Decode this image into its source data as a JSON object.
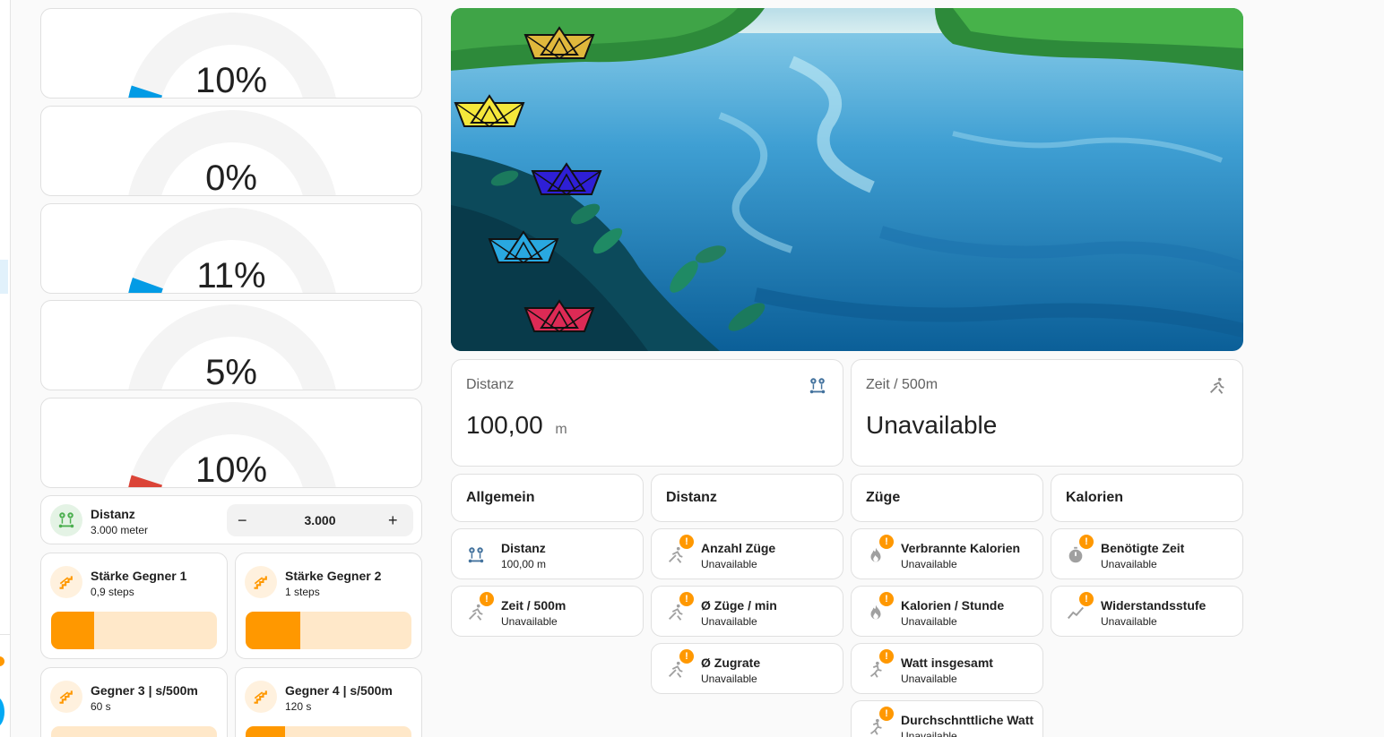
{
  "gauges": [
    {
      "label": "10%",
      "value": 10,
      "color": "#039be5"
    },
    {
      "label": "0%",
      "value": 0,
      "color": "#039be5"
    },
    {
      "label": "11%",
      "value": 11,
      "color": "#039be5"
    },
    {
      "label": "5%",
      "value": 5,
      "color": "#039be5"
    },
    {
      "label": "10%",
      "value": 10,
      "color": "#db4437"
    }
  ],
  "distance_input": {
    "name": "Distanz",
    "sub": "3.000 meter",
    "value": "3.000",
    "minus": "−",
    "plus": "+"
  },
  "opponents": [
    {
      "name": "Stärke Gegner 1",
      "sub": "0,9 steps",
      "fill": 0.26
    },
    {
      "name": "Stärke Gegner 2",
      "sub": "1 steps",
      "fill": 0.33
    },
    {
      "name": "Gegner 3 | s/500m",
      "sub": "60 s",
      "fill": 0.0
    },
    {
      "name": "Gegner 4 | s/500m",
      "sub": "120 s",
      "fill": 0.24
    }
  ],
  "boats": [
    {
      "color": "#e0b83c"
    },
    {
      "color": "#f5e83b"
    },
    {
      "color": "#2e1fd6"
    },
    {
      "color": "#29a8e0"
    },
    {
      "color": "#dd2a55"
    }
  ],
  "stat_distance": {
    "title": "Distanz",
    "value": "100,00",
    "unit": "m"
  },
  "stat_time": {
    "title": "Zeit / 500m",
    "value": "Unavailable"
  },
  "columns": [
    {
      "header": "Allgemein",
      "tiles": [
        {
          "name": "Distanz",
          "state": "100,00 m",
          "icon": "map-marker-distance-icon",
          "warn": false
        },
        {
          "name": "Zeit / 500m",
          "state": "Unavailable",
          "icon": "rowing-icon",
          "warn": true
        }
      ]
    },
    {
      "header": "Distanz",
      "tiles": [
        {
          "name": "Anzahl Züge",
          "state": "Unavailable",
          "icon": "rowing-icon",
          "warn": true
        },
        {
          "name": "Ø Züge / min",
          "state": "Unavailable",
          "icon": "rowing-icon",
          "warn": true
        },
        {
          "name": "Ø Zugrate",
          "state": "Unavailable",
          "icon": "rowing-icon",
          "warn": true
        }
      ]
    },
    {
      "header": "Züge",
      "tiles": [
        {
          "name": "Verbrannte Kalorien",
          "state": "Unavailable",
          "icon": "fire-icon",
          "warn": true
        },
        {
          "name": "Kalorien / Stunde",
          "state": "Unavailable",
          "icon": "fire-icon",
          "warn": true
        },
        {
          "name": "Watt insgesamt",
          "state": "Unavailable",
          "icon": "run-icon",
          "warn": true
        },
        {
          "name": "Durchschnttliche Watt",
          "state": "Unavailable",
          "icon": "run-icon",
          "warn": true
        }
      ]
    },
    {
      "header": "Kalorien",
      "tiles": [
        {
          "name": "Benötigte Zeit",
          "state": "Unavailable",
          "icon": "timer-icon",
          "warn": true
        },
        {
          "name": "Widerstandsstufe",
          "state": "Unavailable",
          "icon": "chart-line-icon",
          "warn": true
        }
      ]
    }
  ],
  "badge_symbol": "!",
  "colors": {
    "accent_orange": "#ff9800",
    "gauge_track": "#f4f4f4",
    "icon_blue": "#44739e"
  }
}
